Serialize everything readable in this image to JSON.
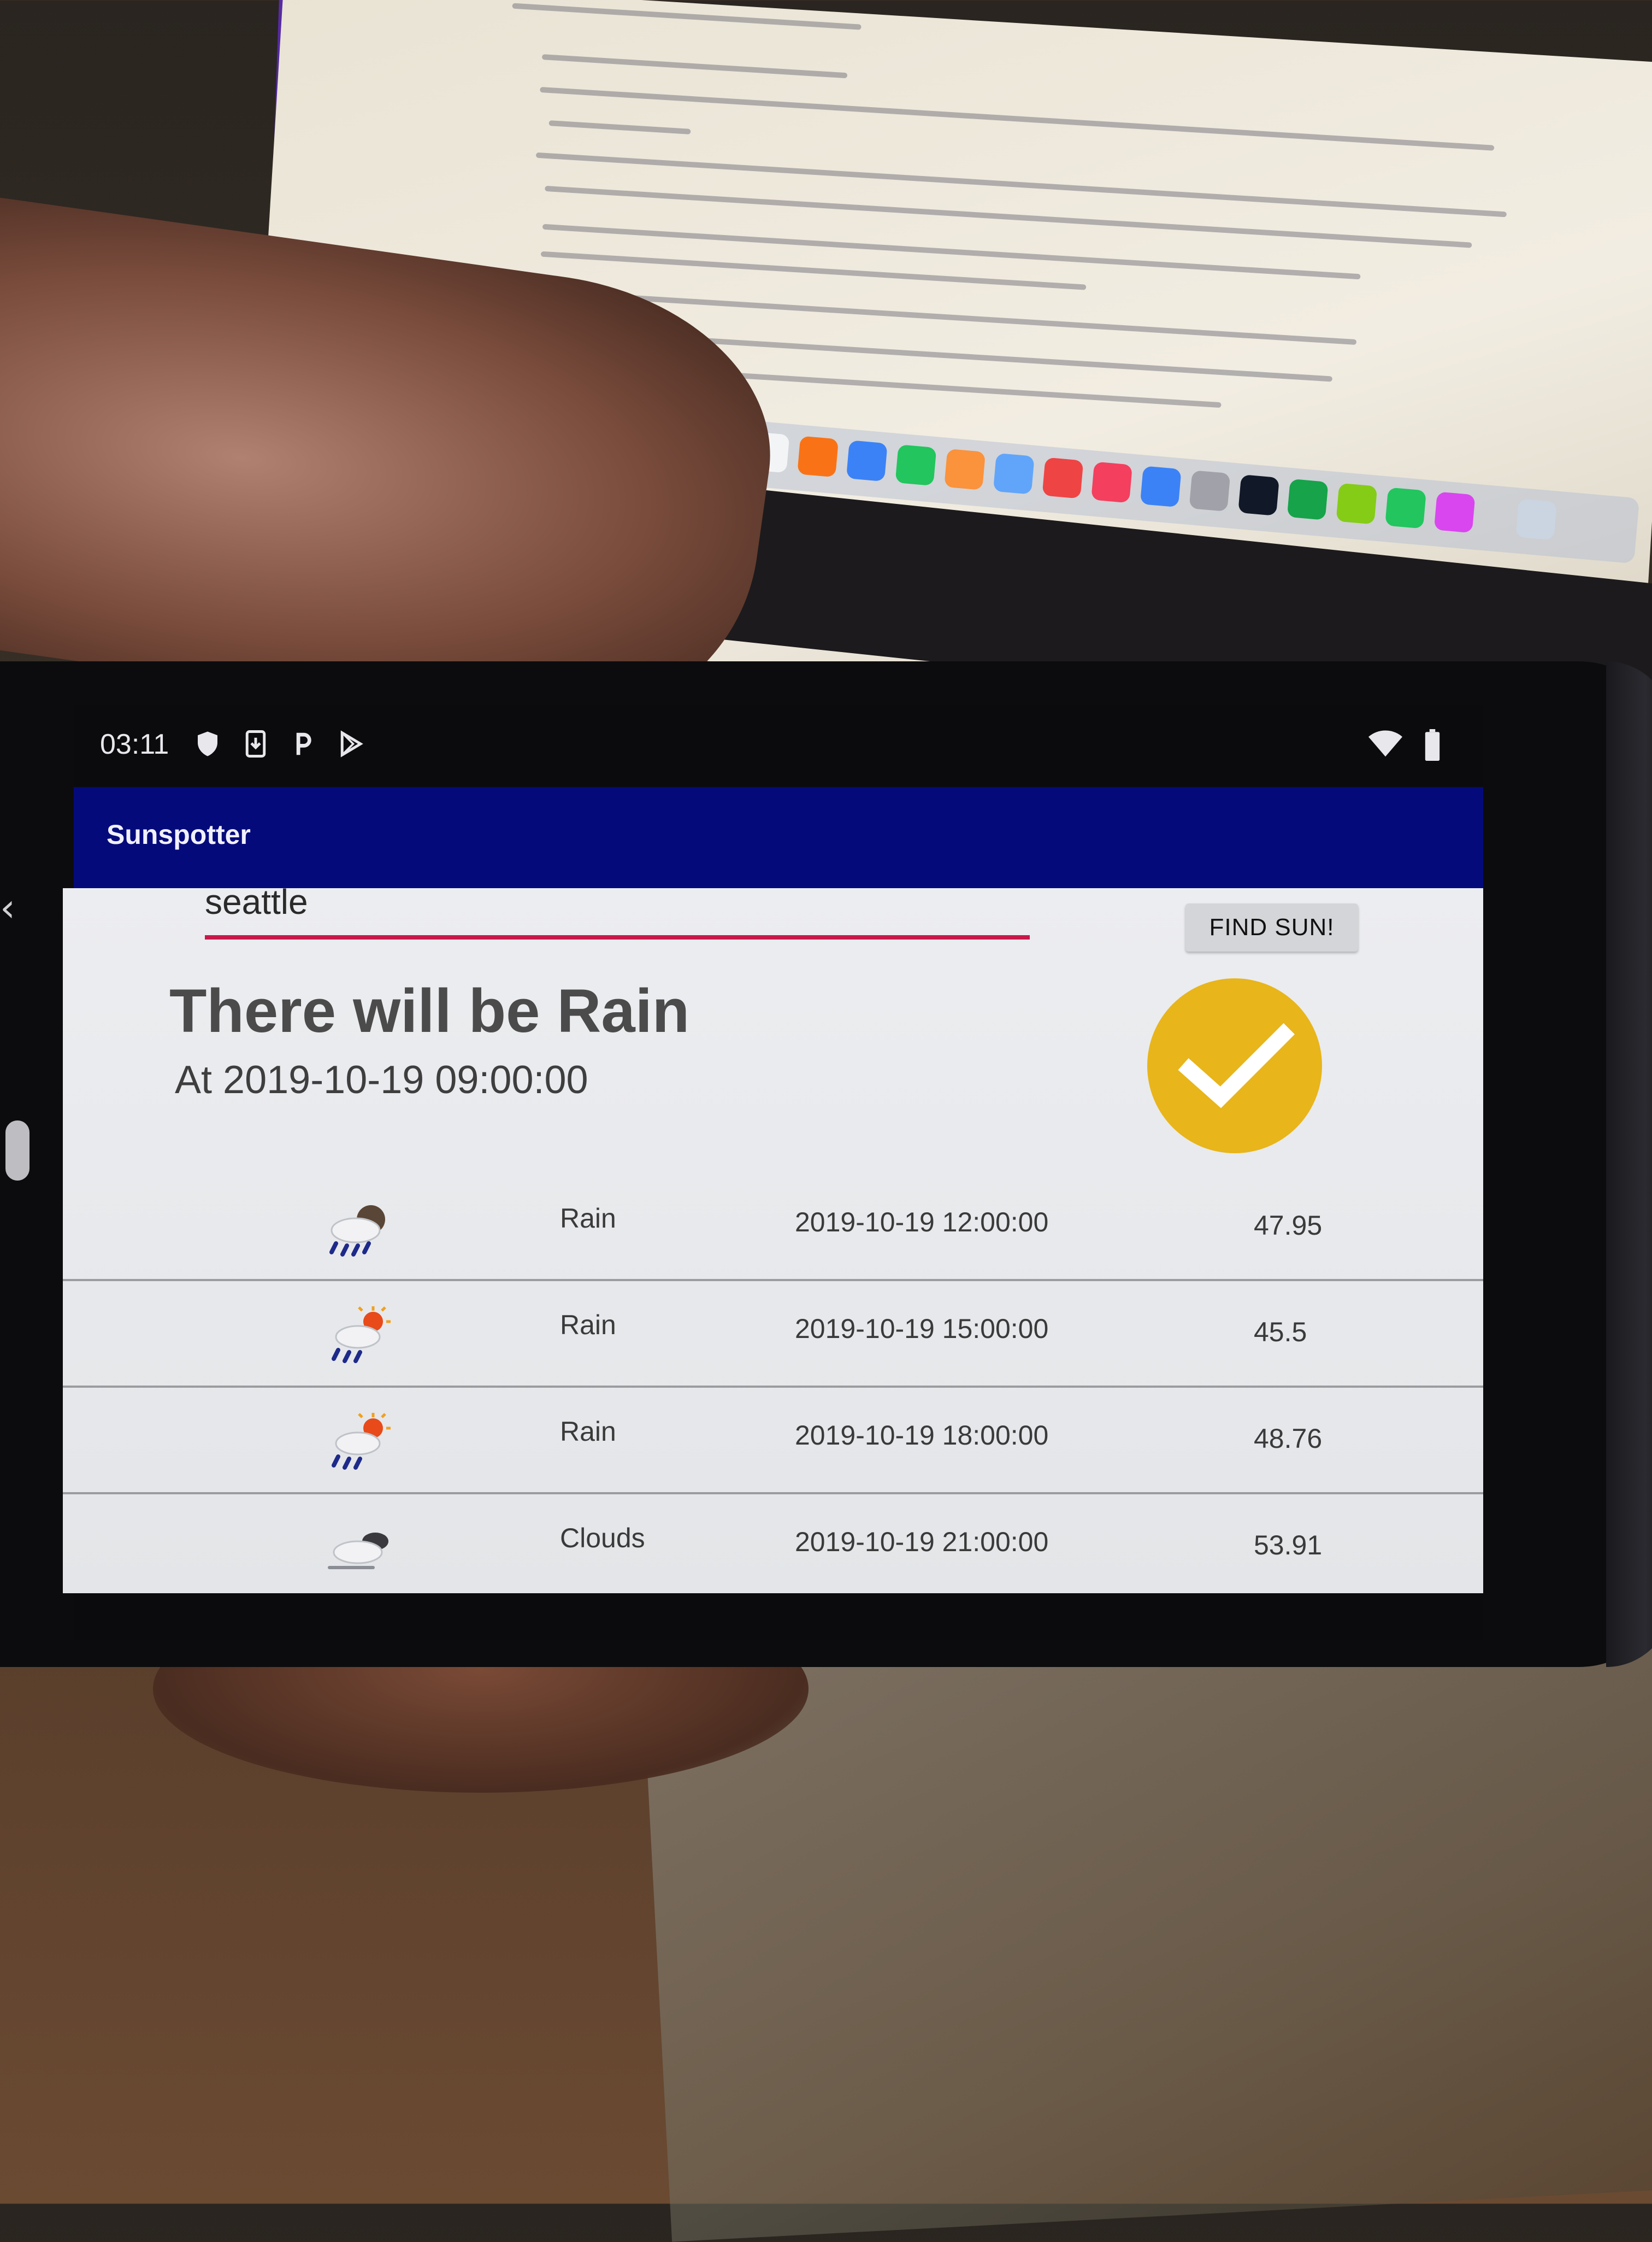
{
  "status_bar": {
    "time": "03:11",
    "left_icons": [
      "shield-icon",
      "download-icon",
      "parking-p-icon",
      "play-store-icon"
    ],
    "right_icons": [
      "wifi-icon",
      "battery-icon"
    ]
  },
  "app_bar": {
    "title": "Sunspotter"
  },
  "search": {
    "value": "seattle",
    "placeholder": ""
  },
  "find_button": {
    "label": "FIND SUN!"
  },
  "result": {
    "headline": "There will be Rain",
    "subline": "At 2019-10-19 09:00:00",
    "badge_icon": "checkmark-icon",
    "badge_color": "#e8b51a"
  },
  "forecast": [
    {
      "icon": "rain-night-icon",
      "description": "Rain",
      "time": "2019-10-19 12:00:00",
      "temp": "47.95"
    },
    {
      "icon": "rain-sun-icon",
      "description": "Rain",
      "time": "2019-10-19 15:00:00",
      "temp": "45.5"
    },
    {
      "icon": "rain-sun-icon",
      "description": "Rain",
      "time": "2019-10-19 18:00:00",
      "temp": "48.76"
    },
    {
      "icon": "clouds-icon",
      "description": "Clouds",
      "time": "2019-10-19 21:00:00",
      "temp": "53.91"
    }
  ],
  "colors": {
    "app_bar": "#050a7a",
    "accent_underline": "#c8184a",
    "background": "#e9eaed"
  }
}
